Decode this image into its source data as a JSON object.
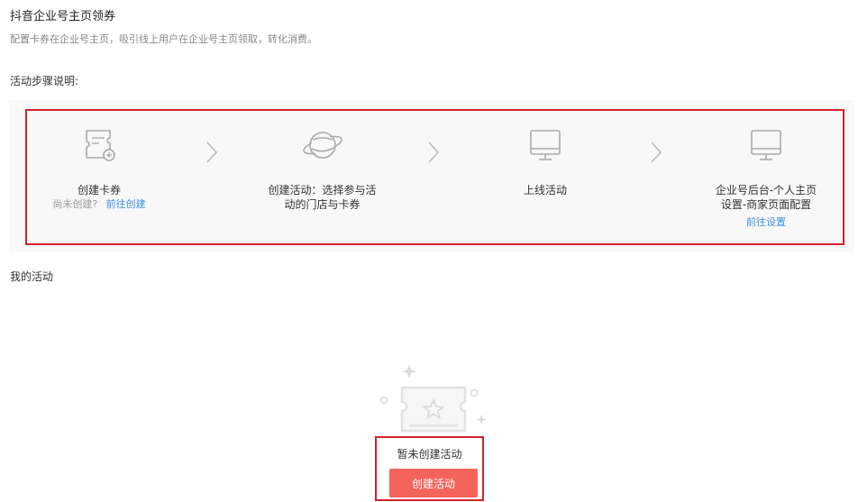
{
  "header": {
    "title": "抖音企业号主页领券",
    "description": "配置卡券在企业号主页，吸引线上用户在企业号主页领取，转化消费。"
  },
  "steps_section": {
    "heading": "活动步骤说明:",
    "steps": [
      {
        "icon": "coupon-add-icon",
        "title": "创建卡券",
        "sub": "尚未创建?",
        "link": "前往创建"
      },
      {
        "icon": "planet-icon",
        "title_line1": "创建活动：选择参与活",
        "title_line2": "动的门店与卡券"
      },
      {
        "icon": "monitor-icon",
        "title": "上线活动"
      },
      {
        "icon": "monitor-icon",
        "title_line1": "企业号后台-个人主页",
        "title_line2": "设置-商家页面配置",
        "link": "前往设置"
      }
    ]
  },
  "my_activity": {
    "heading": "我的活动",
    "empty_text": "暂未创建活动",
    "create_button": "创建活动"
  },
  "colors": {
    "link": "#3b8fe8",
    "button": "#f5645c",
    "highlight": "#d3212e",
    "panel_bg": "#f8f8f8"
  }
}
